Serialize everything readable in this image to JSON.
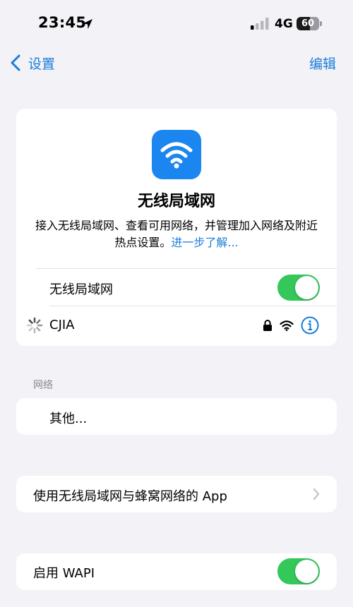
{
  "status_bar": {
    "time": "23:45",
    "network": "4G",
    "battery": "60",
    "icons": [
      "location-arrow-icon",
      "cellular-signal-icon",
      "battery-icon"
    ]
  },
  "nav": {
    "back_label": "设置",
    "edit_label": "编辑",
    "accent_color": "#1a7cd9"
  },
  "hero": {
    "icon": "wifi-icon",
    "icon_color": "#1b86ef",
    "title": "无线局域网",
    "description": "接入无线局域网、查看可用网络，并管理加入网络及附近热点设置。",
    "learn_more": "进一步了解..."
  },
  "wlan_toggle": {
    "label": "无线局域网",
    "on": true,
    "color": "#34c759"
  },
  "connected_network": {
    "name": "CJIA",
    "secured": true,
    "icons": [
      "loading-spinner-icon",
      "lock-icon",
      "wifi-signal-icon",
      "info-icon"
    ]
  },
  "networks_section": {
    "label": "网络",
    "other_label": "其他..."
  },
  "apps_row": {
    "label": "使用无线局域网与蜂窝网络的 App"
  },
  "wapi_toggle": {
    "label": "启用 WAPI",
    "on": true
  }
}
